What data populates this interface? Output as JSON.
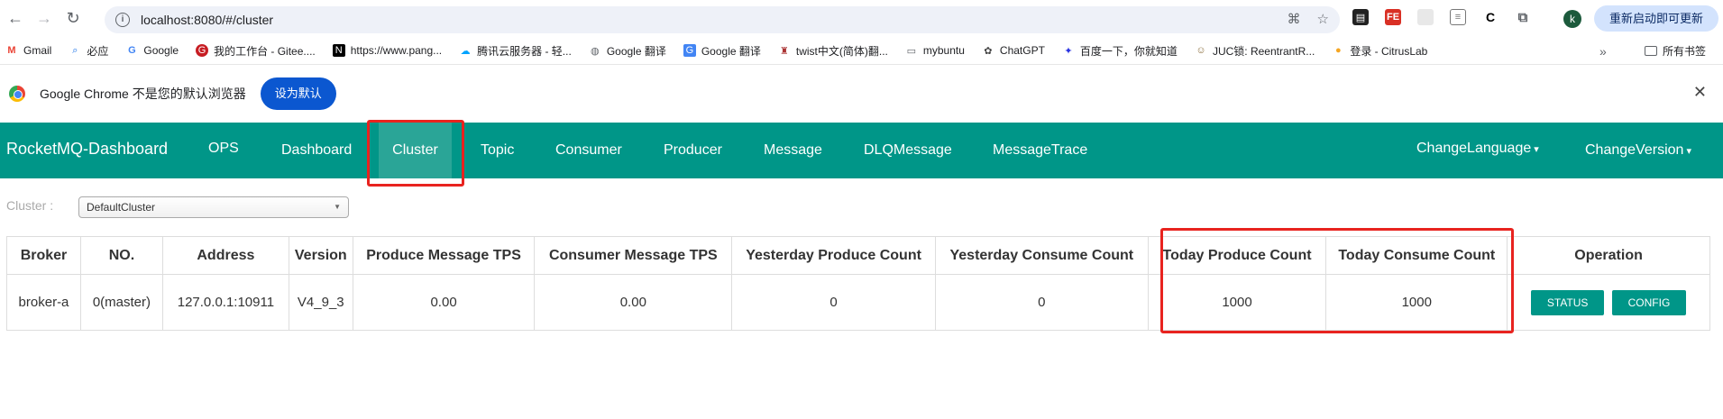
{
  "browser": {
    "url": "localhost:8080/#/cluster",
    "update_button": "重新启动即可更新",
    "profile_initial": "k",
    "extensions": [
      "ext-a",
      "ext-b",
      "ext-c",
      "ext-d",
      "C",
      "puzzle"
    ]
  },
  "bookmarks": {
    "items": [
      {
        "label": "Gmail",
        "icon": "gmail-icon",
        "glyph": "M",
        "color": "#ea4335"
      },
      {
        "label": "必应",
        "icon": "search-icon",
        "glyph": "⌕",
        "color": "#1a73e8"
      },
      {
        "label": "Google",
        "icon": "google-icon",
        "glyph": "G",
        "color": "#4285f4"
      },
      {
        "label": "我的工作台 - Gitee....",
        "icon": "gitee-icon",
        "glyph": "G",
        "color": "#c71d23"
      },
      {
        "label": "https://www.pang...",
        "icon": "notion-icon",
        "glyph": "N",
        "color": "#000000"
      },
      {
        "label": "腾讯云服务器 - 轻...",
        "icon": "cloud-icon",
        "glyph": "☁",
        "color": "#00a3ff"
      },
      {
        "label": "Google 翻译",
        "icon": "globe-icon",
        "glyph": "◍",
        "color": "#5f6368"
      },
      {
        "label": "Google 翻译",
        "icon": "translate-icon",
        "glyph": "G",
        "color": "#4285f4"
      },
      {
        "label": "twist中文(简体)翻...",
        "icon": "dictionary-icon",
        "glyph": "♜",
        "color": "#a33"
      },
      {
        "label": "mybuntu",
        "icon": "folder-icon",
        "glyph": "▭",
        "color": "#5f6368"
      },
      {
        "label": "ChatGPT",
        "icon": "chatgpt-icon",
        "glyph": "✿",
        "color": "#444"
      },
      {
        "label": "百度一下，你就知道",
        "icon": "baidu-icon",
        "glyph": "✦",
        "color": "#2932e1"
      },
      {
        "label": "JUC锁: ReentrantR...",
        "icon": "avatar-icon",
        "glyph": "☺",
        "color": "#8a6d3b"
      },
      {
        "label": "登录 - CitrusLab",
        "icon": "citrus-icon",
        "glyph": "●",
        "color": "#f5a623"
      }
    ],
    "more": "»",
    "all_bookmarks": "所有书签"
  },
  "infobar": {
    "message": "Google Chrome 不是您的默认浏览器",
    "button": "设为默认",
    "close": "✕"
  },
  "nav": {
    "brand": "RocketMQ-Dashboard",
    "items": [
      "OPS",
      "Dashboard",
      "Cluster",
      "Topic",
      "Consumer",
      "Producer",
      "Message",
      "DLQMessage",
      "MessageTrace"
    ],
    "active": "Cluster",
    "change_language": "ChangeLanguage",
    "change_version": "ChangeVersion"
  },
  "cluster": {
    "label": "Cluster :",
    "selected": "DefaultCluster"
  },
  "table": {
    "headers": [
      "Broker",
      "NO.",
      "Address",
      "Version",
      "Produce Message TPS",
      "Consumer Message TPS",
      "Yesterday Produce Count",
      "Yesterday Consume Count",
      "Today Produce Count",
      "Today Consume Count",
      "Operation"
    ],
    "rows": [
      {
        "broker": "broker-a",
        "no": "0(master)",
        "address": "127.0.0.1:10911",
        "version": "V4_9_3",
        "produce_tps": "0.00",
        "consumer_tps": "0.00",
        "yesterday_produce": "0",
        "yesterday_consume": "0",
        "today_produce": "1000",
        "today_consume": "1000"
      }
    ],
    "buttons": {
      "status": "STATUS",
      "config": "CONFIG"
    }
  },
  "colors": {
    "nav_bg": "#009688",
    "nav_active": "#2aa597",
    "highlight": "#e8231f",
    "button_bg": "#009688"
  }
}
